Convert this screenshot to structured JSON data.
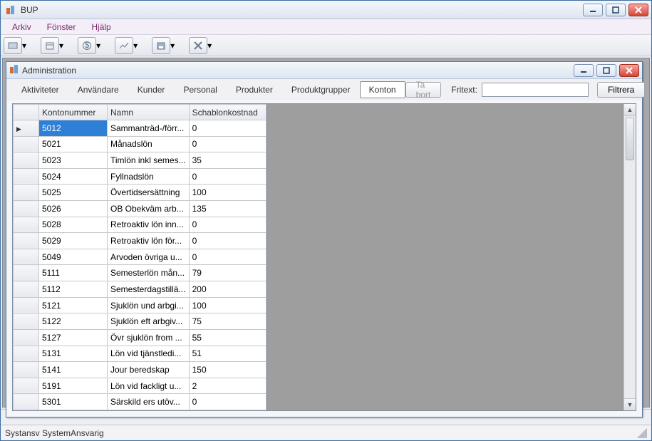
{
  "window": {
    "title": "BUP"
  },
  "menu": {
    "items": [
      "Arkiv",
      "Fönster",
      "Hjälp"
    ]
  },
  "toolbar": {
    "buttons": [
      "pos-icon",
      "box-icon",
      "dollar-icon",
      "chart-icon",
      "save-icon",
      "tools-icon"
    ]
  },
  "inner": {
    "title": "Administration",
    "tabs": [
      "Aktiviteter",
      "Användare",
      "Kunder",
      "Personal",
      "Produkter",
      "Produktgrupper",
      "Konton"
    ],
    "active_tab": "Konton",
    "delete_label": "Ta bort",
    "fritext_label": "Fritext:",
    "fritext_value": "",
    "filter_label": "Filtrera"
  },
  "grid": {
    "columns": [
      "Kontonummer",
      "Namn",
      "Schablonkostnad"
    ],
    "rows": [
      {
        "k": "5012",
        "n": "Sammanträd-/förr...",
        "s": "0",
        "selected": true
      },
      {
        "k": "5021",
        "n": "Månadslön",
        "s": "0"
      },
      {
        "k": "5023",
        "n": "Timlön inkl semes...",
        "s": "35"
      },
      {
        "k": "5024",
        "n": "Fyllnadslön",
        "s": "0"
      },
      {
        "k": "5025",
        "n": "Övertidsersättning",
        "s": "100"
      },
      {
        "k": "5026",
        "n": "OB Obekväm arb...",
        "s": "135"
      },
      {
        "k": "5028",
        "n": "Retroaktiv lön inn...",
        "s": "0"
      },
      {
        "k": "5029",
        "n": "Retroaktiv lön för...",
        "s": "0"
      },
      {
        "k": "5049",
        "n": "Arvoden övriga u...",
        "s": "0"
      },
      {
        "k": "5111",
        "n": "Semesterlön mån...",
        "s": "79"
      },
      {
        "k": "5112",
        "n": "Semesterdagstillä...",
        "s": "200"
      },
      {
        "k": "5121",
        "n": "Sjuklön und arbgi...",
        "s": "100"
      },
      {
        "k": "5122",
        "n": "Sjuklön eft arbgiv...",
        "s": "75"
      },
      {
        "k": "5127",
        "n": "Övr sjuklön from ...",
        "s": "55"
      },
      {
        "k": "5131",
        "n": "Lön vid tjänstledi...",
        "s": "51"
      },
      {
        "k": "5141",
        "n": "Jour beredskap",
        "s": "150"
      },
      {
        "k": "5191",
        "n": "Lön vid fackligt u...",
        "s": "2"
      },
      {
        "k": "5301",
        "n": "Särskild ers utöv...",
        "s": "0"
      }
    ]
  },
  "statusbar": {
    "text": "Systansv SystemAnsvarig"
  }
}
